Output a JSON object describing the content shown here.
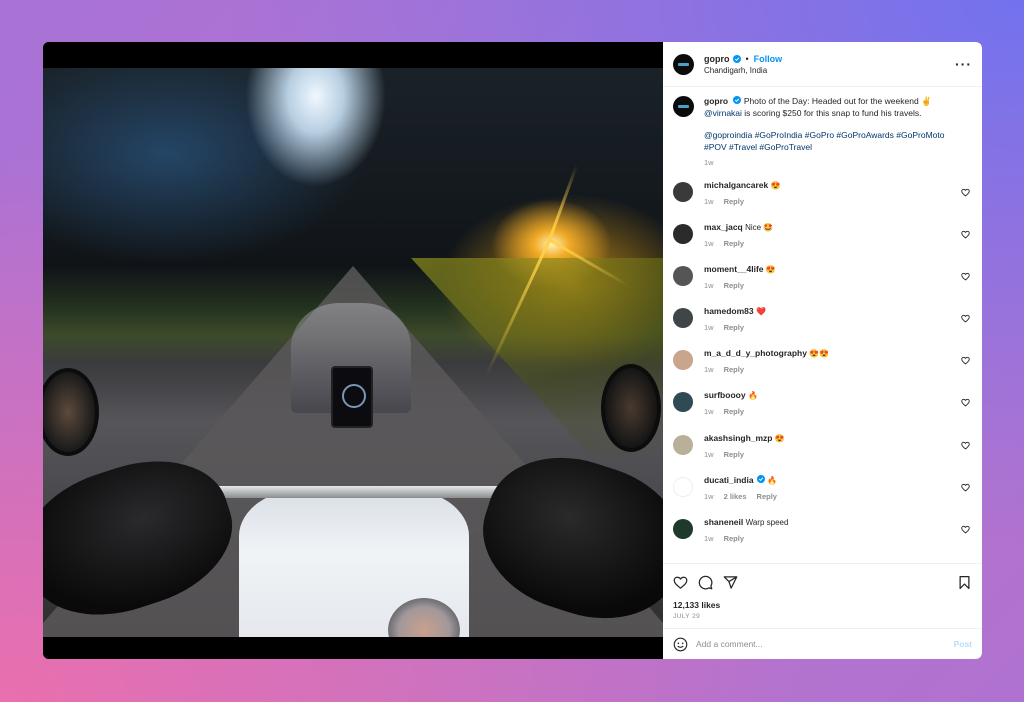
{
  "post": {
    "author": "gopro",
    "verified": true,
    "follow_label": "Follow",
    "location": "Chandigarh, India",
    "more_icon": "more-horizontal-icon",
    "caption": {
      "username": "gopro",
      "text": "Photo of the Day: Headed out for the weekend ✌️",
      "mention": "@virnakai",
      "text2": " is scoring $250 for this snap to fund his travels.",
      "tags_line1": "@goproindia #GoProIndia #GoPro #GoProAwards #GoProMoto",
      "tags_line2": "#POV #Travel #GoProTravel",
      "time": "1w"
    },
    "likes": "12,133 likes",
    "date": "JULY 29",
    "add_comment_placeholder": "Add a comment...",
    "post_label": "Post"
  },
  "comments": [
    {
      "user": "michalgancarek",
      "text": "😍",
      "time": "1w",
      "likes": "",
      "reply": "Reply",
      "avatar_color": "#3a3a3a"
    },
    {
      "user": "max_jacq",
      "text": "Nice 🤩",
      "time": "1w",
      "likes": "",
      "reply": "Reply",
      "avatar_color": "#2b2b2b"
    },
    {
      "user": "moment__4life",
      "text": "😍",
      "time": "1w",
      "likes": "",
      "reply": "Reply",
      "avatar_color": "#555555"
    },
    {
      "user": "hamedom83",
      "text": "❤️",
      "time": "1w",
      "likes": "",
      "reply": "Reply",
      "avatar_color": "#3f4648"
    },
    {
      "user": "m_a_d_d_y_photography",
      "text": "😍😍",
      "time": "1w",
      "likes": "",
      "reply": "Reply",
      "avatar_color": "#c9a58e"
    },
    {
      "user": "surfboooy",
      "text": "🔥",
      "time": "1w",
      "likes": "",
      "reply": "Reply",
      "avatar_color": "#2f4a55"
    },
    {
      "user": "akashsingh_mzp",
      "text": "😍",
      "time": "1w",
      "likes": "",
      "reply": "Reply",
      "avatar_color": "#b9b09a"
    },
    {
      "user": "ducati_india",
      "text": "🔥",
      "time": "1w",
      "likes": "2 likes",
      "reply": "Reply",
      "avatar_color": "#ffffff",
      "verified": true
    },
    {
      "user": "shaneneil",
      "text": "Warp speed",
      "time": "1w",
      "likes": "",
      "reply": "Reply",
      "avatar_color": "#1e3a2a"
    }
  ],
  "colors": {
    "link": "#0095f6",
    "hashtag": "#00376b",
    "verified": "#0095f6",
    "post_disabled": "#b2dffc"
  }
}
